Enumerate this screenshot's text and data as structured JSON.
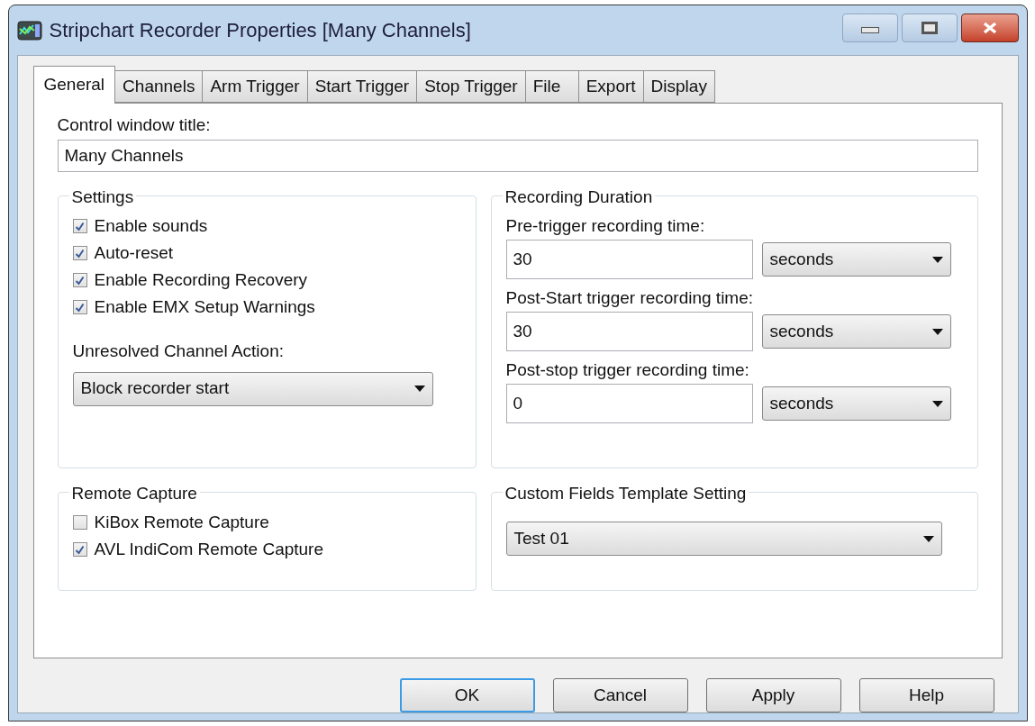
{
  "window": {
    "title": "Stripchart Recorder Properties [Many Channels]"
  },
  "tabs": [
    {
      "label": "General",
      "selected": true
    },
    {
      "label": "Channels",
      "selected": false
    },
    {
      "label": "Arm Trigger",
      "selected": false
    },
    {
      "label": "Start Trigger",
      "selected": false
    },
    {
      "label": "Stop Trigger",
      "selected": false
    },
    {
      "label": "File",
      "selected": false
    },
    {
      "label": "Export",
      "selected": false
    },
    {
      "label": "Display",
      "selected": false
    }
  ],
  "control_window_title": {
    "label": "Control window title:",
    "value": "Many Channels"
  },
  "settings": {
    "title": "Settings",
    "checkboxes": [
      {
        "label": "Enable sounds",
        "checked": true
      },
      {
        "label": "Auto-reset",
        "checked": true
      },
      {
        "label": "Enable Recording Recovery",
        "checked": true
      },
      {
        "label": "Enable EMX Setup Warnings",
        "checked": true
      }
    ],
    "unresolved_action": {
      "label": "Unresolved Channel Action:",
      "value": "Block recorder start"
    }
  },
  "recording_duration": {
    "title": "Recording Duration",
    "fields": [
      {
        "label": "Pre-trigger recording time:",
        "value": "30",
        "unit": "seconds"
      },
      {
        "label": "Post-Start trigger recording time:",
        "value": "30",
        "unit": "seconds"
      },
      {
        "label": "Post-stop trigger recording time:",
        "value": "0",
        "unit": "seconds"
      }
    ]
  },
  "remote_capture": {
    "title": "Remote Capture",
    "checkboxes": [
      {
        "label": "KiBox Remote Capture",
        "checked": false
      },
      {
        "label": "AVL IndiCom Remote Capture",
        "checked": true
      }
    ]
  },
  "custom_fields": {
    "title": "Custom Fields Template Setting",
    "value": "Test 01"
  },
  "buttons": [
    {
      "label": "OK",
      "focused": true
    },
    {
      "label": "Cancel",
      "focused": false
    },
    {
      "label": "Apply",
      "focused": false
    },
    {
      "label": "Help",
      "focused": false
    }
  ]
}
